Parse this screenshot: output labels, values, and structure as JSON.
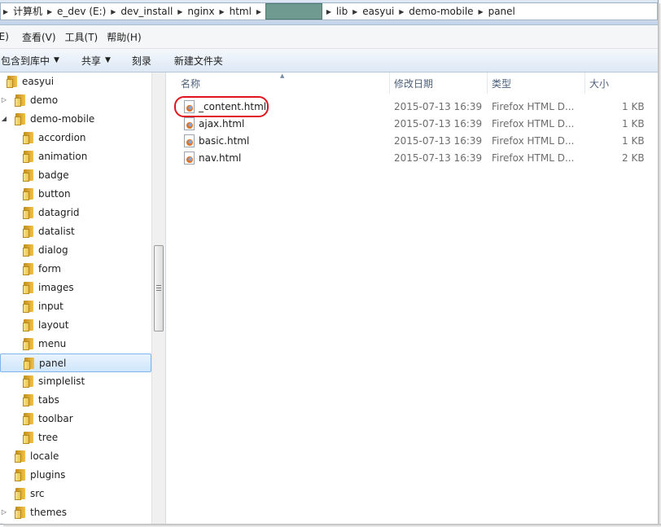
{
  "address_bar": {
    "crumbs": [
      "计算机",
      "e_dev (E:)",
      "dev_install",
      "nginx",
      "html",
      "lib",
      "easyui",
      "demo-mobile",
      "panel"
    ]
  },
  "menu": [
    "(E)",
    "查看(V)",
    "工具(T)",
    "帮助(H)"
  ],
  "toolbar": {
    "include_library": "包含到库中",
    "share": "共享",
    "burn": "刻录",
    "new_folder": "新建文件夹"
  },
  "nav_tree": [
    {
      "label": "easyui",
      "expanded": true
    },
    {
      "label": "demo",
      "expanded": false
    },
    {
      "label": "demo-mobile",
      "expanded": true
    },
    {
      "label": "accordion"
    },
    {
      "label": "animation"
    },
    {
      "label": "badge"
    },
    {
      "label": "button"
    },
    {
      "label": "datagrid"
    },
    {
      "label": "datalist"
    },
    {
      "label": "dialog"
    },
    {
      "label": "form"
    },
    {
      "label": "images"
    },
    {
      "label": "input"
    },
    {
      "label": "layout"
    },
    {
      "label": "menu"
    },
    {
      "label": "panel",
      "selected": true
    },
    {
      "label": "simplelist"
    },
    {
      "label": "tabs"
    },
    {
      "label": "toolbar"
    },
    {
      "label": "tree"
    },
    {
      "label": "locale"
    },
    {
      "label": "plugins"
    },
    {
      "label": "src"
    },
    {
      "label": "themes",
      "expanded": false
    }
  ],
  "columns": {
    "name": "名称",
    "modified": "修改日期",
    "type": "类型",
    "size": "大小"
  },
  "files": [
    {
      "name": "_content.html",
      "modified": "2015-07-13 16:39",
      "type": "Firefox HTML D...",
      "size": "1 KB",
      "highlighted": true
    },
    {
      "name": "ajax.html",
      "modified": "2015-07-13 16:39",
      "type": "Firefox HTML D...",
      "size": "1 KB"
    },
    {
      "name": "basic.html",
      "modified": "2015-07-13 16:39",
      "type": "Firefox HTML D...",
      "size": "1 KB"
    },
    {
      "name": "nav.html",
      "modified": "2015-07-13 16:39",
      "type": "Firefox HTML D...",
      "size": "2 KB"
    }
  ],
  "colors": {
    "selection_border": "#7eb4ea",
    "highlight_ring": "#e0141e",
    "redacted_block": "#6f9a90"
  },
  "icons": {
    "folder": "folder-icon",
    "html_file": "firefox-html-icon",
    "expand": "triangle-right-icon",
    "collapse": "triangle-down-icon"
  }
}
